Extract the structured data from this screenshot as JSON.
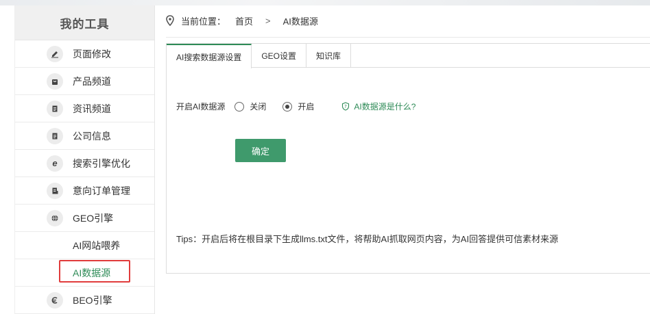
{
  "sidebar": {
    "title": "我的工具",
    "items": [
      {
        "label": "页面修改",
        "icon": "edit-icon"
      },
      {
        "label": "产品频道",
        "icon": "shopping-bag-icon"
      },
      {
        "label": "资讯频道",
        "icon": "document-icon"
      },
      {
        "label": "公司信息",
        "icon": "document-icon"
      },
      {
        "label": "搜索引擎优化",
        "icon": "ie-icon"
      },
      {
        "label": "意向订单管理",
        "icon": "order-icon"
      },
      {
        "label": "GEO引擎",
        "icon": "globe-icon"
      }
    ],
    "sub_items": [
      {
        "label": "AI网站喂养"
      },
      {
        "label": "AI数据源"
      }
    ],
    "bottom_item": {
      "label": "BEO引擎",
      "icon": "beo-icon"
    }
  },
  "breadcrumb": {
    "prefix": "当前位置：",
    "home": "首页",
    "separator": ">",
    "current": "AI数据源"
  },
  "tabs": [
    {
      "label": "AI搜索数据源设置",
      "active": true
    },
    {
      "label": "GEO设置",
      "active": false
    },
    {
      "label": "知识库",
      "active": false
    }
  ],
  "form": {
    "label": "开启AI数据源",
    "options": [
      {
        "label": "关闭",
        "checked": false
      },
      {
        "label": "开启",
        "checked": true
      }
    ],
    "help_text": "AI数据源是什么?"
  },
  "confirm_label": "确定",
  "tips": "Tips：开启后将在根目录下生成llms.txt文件，将帮助AI抓取网页内容，为AI回答提供可信素材来源",
  "colors": {
    "accent": "#3f9a6c",
    "highlight": "#e03b3b"
  }
}
